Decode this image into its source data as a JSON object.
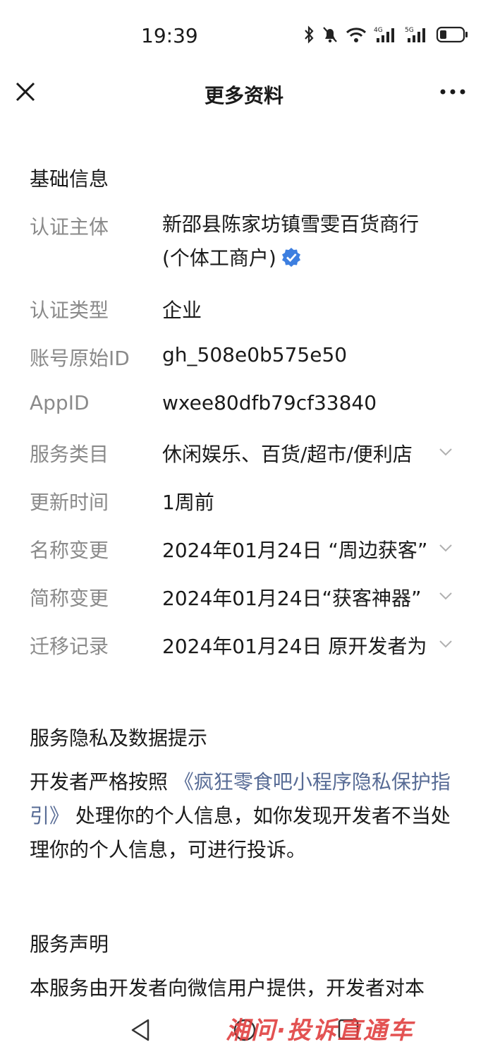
{
  "status_bar": {
    "time": "19:39",
    "network_1": "4G",
    "network_2": "5G"
  },
  "nav": {
    "title": "更多资料",
    "close_icon": "close-icon",
    "more_icon": "more-icon"
  },
  "basic_info": {
    "section_title": "基础信息",
    "rows": [
      {
        "label": "认证主体",
        "value": "新邵县陈家坊镇雪雯百货商行(个体工商户)",
        "verified": true
      },
      {
        "label": "认证类型",
        "value": "企业"
      },
      {
        "label": "账号原始ID",
        "value": "gh_508e0b575e50"
      },
      {
        "label": "AppID",
        "value": "wxee80dfb79cf33840"
      },
      {
        "label": "服务类目",
        "value": "休闲娱乐、百货/超市/便利店",
        "expandable": true
      },
      {
        "label": "更新时间",
        "value": "1周前"
      },
      {
        "label": "名称变更",
        "value": "2024年01月24日 “周边获客”",
        "expandable": true
      },
      {
        "label": "简称变更",
        "value": "2024年01月24日“获客神器”",
        "expandable": true
      },
      {
        "label": "迁移记录",
        "value": "2024年01月24日 原开发者为",
        "expandable": true
      }
    ]
  },
  "privacy": {
    "section_title": "服务隐私及数据提示",
    "text_before": "开发者严格按照",
    "link_text": "《疯狂零食吧小程序隐私保护指引》",
    "text_after": "处理你的个人信息，如你发现开发者不当处理你的个人信息，可进行投诉。"
  },
  "statement": {
    "section_title": "服务声明",
    "text": "本服务由开发者向微信用户提供，开发者对本"
  },
  "watermark": "湘问·投诉直通车",
  "colors": {
    "link": "#576b95",
    "label": "#8a8a8a",
    "verified": "#3d7fe0"
  }
}
